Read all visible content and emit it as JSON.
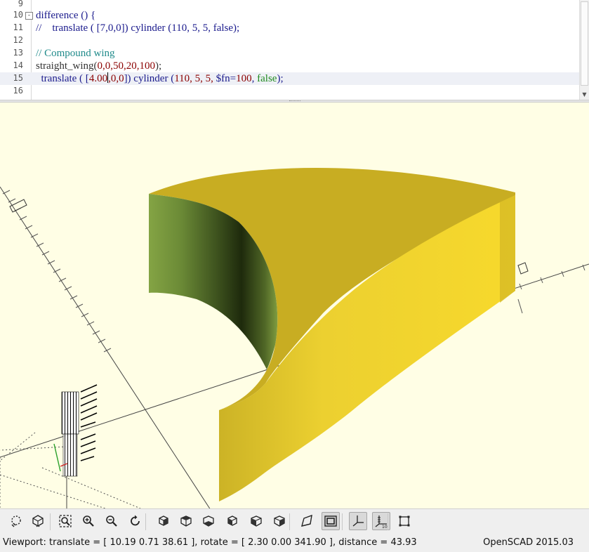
{
  "editor": {
    "lines": [
      {
        "num": "9",
        "segments": []
      },
      {
        "num": "10",
        "fold": "-",
        "segments": [
          {
            "t": "difference () {",
            "c": "kw"
          }
        ]
      },
      {
        "num": "11",
        "segments": [
          {
            "t": "//    translate ( [7,0,0]) cylinder (110, 5, 5, false);",
            "c": "kw"
          }
        ]
      },
      {
        "num": "12",
        "segments": []
      },
      {
        "num": "13",
        "segments": [
          {
            "t": "// Compound wing",
            "c": "cm"
          }
        ]
      },
      {
        "num": "14",
        "segments": [
          {
            "t": "straight_wing(",
            "c": "df"
          },
          {
            "t": "0,0,50,20,100",
            "c": "nm"
          },
          {
            "t": ");",
            "c": "df"
          }
        ]
      },
      {
        "num": "15",
        "current": true,
        "segments": [
          {
            "t": "  translate ( [",
            "c": "kw"
          },
          {
            "t": "4.00",
            "c": "nm"
          },
          {
            "t": "|",
            "c": "cursor"
          },
          {
            "t": ",0,0",
            "c": "nm"
          },
          {
            "t": "]) cylinder (",
            "c": "kw"
          },
          {
            "t": "110, 5, 5, ",
            "c": "nm"
          },
          {
            "t": "$fn=",
            "c": "kw"
          },
          {
            "t": "100",
            "c": "nm"
          },
          {
            "t": ", ",
            "c": "kw"
          },
          {
            "t": "false",
            "c": "bl"
          },
          {
            "t": ");",
            "c": "kw"
          }
        ]
      },
      {
        "num": "16",
        "segments": []
      }
    ]
  },
  "viewport": {
    "background": "#fffee5",
    "model_top_color": "#c8ad22",
    "model_side_color": "#f2d42c",
    "model_inner_color": "#7a9a3e"
  },
  "toolbar": {
    "buttons": [
      {
        "name": "preview-button",
        "icon": "preview-icon"
      },
      {
        "name": "render-button",
        "icon": "render-icon"
      },
      {
        "name": "view-all-button",
        "icon": "view-all-icon"
      },
      {
        "name": "zoom-in-button",
        "icon": "zoom-in-icon"
      },
      {
        "name": "zoom-out-button",
        "icon": "zoom-out-icon"
      },
      {
        "name": "reset-view-button",
        "icon": "reset-view-icon"
      },
      {
        "name": "view-right-button",
        "icon": "view-right-icon"
      },
      {
        "name": "view-top-button",
        "icon": "view-top-icon"
      },
      {
        "name": "view-bottom-button",
        "icon": "view-bottom-icon"
      },
      {
        "name": "view-left-button",
        "icon": "view-left-icon"
      },
      {
        "name": "view-front-button",
        "icon": "view-front-icon"
      },
      {
        "name": "view-back-button",
        "icon": "view-back-icon"
      },
      {
        "name": "perspective-button",
        "icon": "perspective-icon"
      },
      {
        "name": "orthogonal-button",
        "icon": "orthogonal-icon",
        "pressed": true
      },
      {
        "name": "show-axes-button",
        "icon": "axes-icon",
        "pressed": true
      },
      {
        "name": "show-scale-button",
        "icon": "scale-markers-icon",
        "pressed": true
      },
      {
        "name": "show-edges-button",
        "icon": "edges-icon"
      }
    ]
  },
  "status": {
    "viewport_text": "Viewport: translate = [ 10.19 0.71 38.61 ], rotate = [ 2.30 0.00 341.90 ], distance = 43.93",
    "app_version": "OpenSCAD 2015.03"
  }
}
